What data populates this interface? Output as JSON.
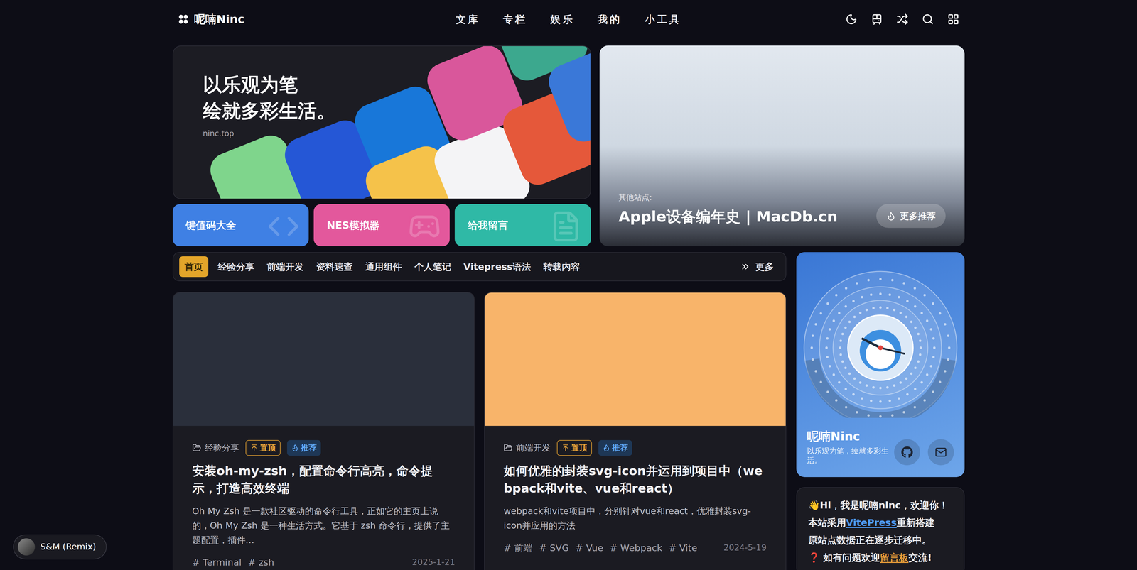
{
  "nav": {
    "brand": "呢喃Ninc",
    "menu": [
      "文库",
      "专栏",
      "娱乐",
      "我的",
      "小工具"
    ]
  },
  "banner": {
    "title_lines": [
      "以乐观为笔",
      "绘就多彩生活。"
    ],
    "site": "ninc.top"
  },
  "quick_links": [
    {
      "label": "键值码大全",
      "color": "#3f80e4"
    },
    {
      "label": "NES模拟器",
      "color": "#e3589c"
    },
    {
      "label": "给我留言",
      "color": "#2fb9a6"
    }
  ],
  "featured": {
    "caption": "其他站点:",
    "title": "Apple设备编年史 | MacDb.cn",
    "button": "更多推荐"
  },
  "categories": {
    "items": [
      {
        "label": "首页",
        "selected": true
      },
      {
        "label": "经验分享",
        "selected": false
      },
      {
        "label": "前端开发",
        "selected": false
      },
      {
        "label": "资料速查",
        "selected": false
      },
      {
        "label": "通用组件",
        "selected": false
      },
      {
        "label": "个人笔记",
        "selected": false
      },
      {
        "label": "Vitepress语法",
        "selected": false
      },
      {
        "label": "转载内容",
        "selected": false
      }
    ],
    "more": "更多"
  },
  "tag_prefix": "#",
  "posts": [
    {
      "color": "#2a2f3b",
      "category": "经验分享",
      "badges": [
        {
          "label": "置顶",
          "kind": "pinned"
        },
        {
          "label": "推荐",
          "kind": "recommended"
        }
      ],
      "title": "安装oh-my-zsh，配置命令行高亮，命令提示，打造高效终端",
      "excerpt": "Oh My Zsh 是一款社区驱动的命令行工具，正如它的主页上说的，Oh My Zsh 是一种生活方式。它基于 zsh 命令行，提供了主题配置，插件…",
      "tags": [
        "Terminal",
        "zsh"
      ],
      "date": "2025-1-21"
    },
    {
      "color": "#f8b46a",
      "category": "前端开发",
      "badges": [
        {
          "label": "置顶",
          "kind": "pinned"
        },
        {
          "label": "推荐",
          "kind": "recommended"
        }
      ],
      "title": "如何优雅的封装svg-icon并运用到项目中（webpack和vite、vue和react）",
      "excerpt": "webpack和vite项目中，分别针对vue和react，优雅封装svg-icon并应用的方法",
      "tags": [
        "前端",
        "SVG",
        "Vue",
        "Webpack",
        "Vite"
      ],
      "date": "2024-5-19"
    }
  ],
  "profile": {
    "name": "呢喃Ninc",
    "motto": "以乐观为笔，绘就多彩生活。"
  },
  "notice": {
    "lines": [
      [
        {
          "text": "👋Hi，我是呢喃ninc，欢迎你！",
          "kind": "text"
        }
      ],
      [
        {
          "text": "本站采用",
          "kind": "text"
        },
        {
          "text": "VitePress",
          "kind": "link",
          "color": "#4f9cf5"
        },
        {
          "text": "重新搭建",
          "kind": "text"
        }
      ],
      [
        {
          "text": "原站点数据正在逐步迁移中。",
          "kind": "text"
        }
      ],
      [
        {
          "text": "❓",
          "kind": "text"
        },
        {
          "text": " 如有问题欢迎",
          "kind": "text"
        },
        {
          "text": "留言板",
          "kind": "link",
          "color": "#f0a23a"
        },
        {
          "text": "交流!",
          "kind": "text"
        }
      ]
    ]
  },
  "player": {
    "track": "S&M (Remix)"
  }
}
